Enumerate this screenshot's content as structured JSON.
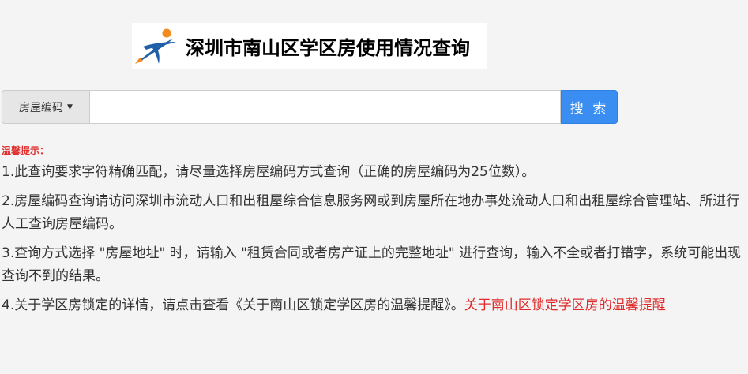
{
  "banner": {
    "title": "深圳市南山区学区房使用情况查询",
    "logo_icon": "runner-logo-icon"
  },
  "search": {
    "select_label": "房屋编码",
    "caret": "▼",
    "input_value": "",
    "placeholder": "",
    "button_label": "搜 索"
  },
  "tips": {
    "title": "温馨提示：",
    "items": [
      "1.此查询要求字符精确匹配，请尽量选择房屋编码方式查询（正确的房屋编码为25位数）。",
      "2.房屋编码查询请访问深圳市流动人口和出租屋综合信息服务网或到房屋所在地办事处流动人口和出租屋综合管理站、所进行人工查询房屋编码。",
      "3.查询方式选择 \"房屋地址\" 时，请输入 \"租赁合同或者房产证上的完整地址\" 进行查询，输入不全或者打错字，系统可能出现查询不到的结果。",
      "4.关于学区房锁定的详情，请点击查看《关于南山区锁定学区房的温馨提醒》。"
    ],
    "link_text": "关于南山区锁定学区房的温馨提醒"
  },
  "colors": {
    "background": "#f4f4f4",
    "accent_blue": "#3b8ef1",
    "tip_red": "#e03030",
    "logo_blue": "#1f5fa8",
    "logo_orange": "#f28a1e"
  }
}
